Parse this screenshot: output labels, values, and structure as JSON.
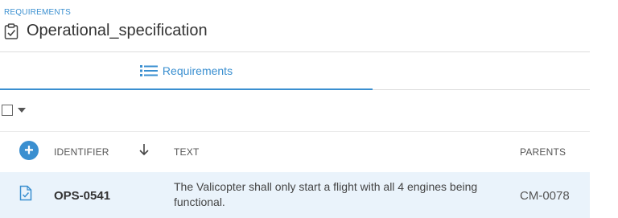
{
  "header": {
    "breadcrumb": "REQUIREMENTS",
    "title": "Operational_specification",
    "title_icon": "clipboard-check-icon"
  },
  "tabs": [
    {
      "label": "Requirements",
      "icon": "list-icon",
      "active": true
    }
  ],
  "table": {
    "columns": {
      "identifier": "IDENTIFIER",
      "text": "TEXT",
      "parents": "PARENTS"
    },
    "sort": {
      "column": "identifier",
      "direction": "descending"
    },
    "rows": [
      {
        "identifier": "OPS-0541",
        "text": "The Valicopter shall only start a flight with all 4 engines being functional.",
        "parents": "CM-0078",
        "icon": "document-check-icon"
      }
    ]
  },
  "colors": {
    "accent": "#3a8fd0",
    "row_highlight": "#eaf3fb"
  }
}
